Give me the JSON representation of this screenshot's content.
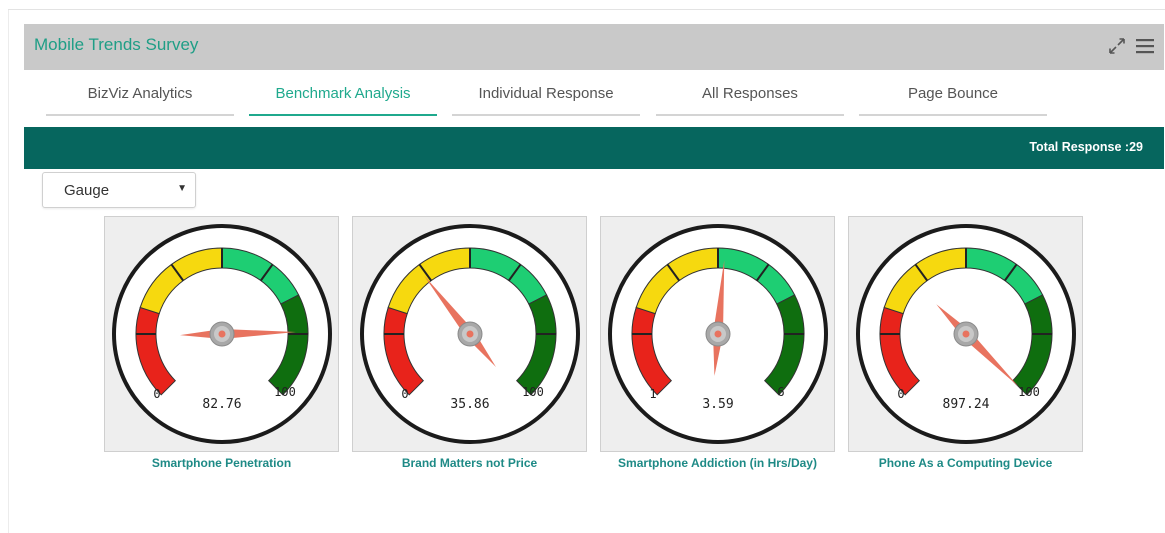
{
  "header": {
    "title": "Mobile Trends Survey",
    "icons": [
      "expand-icon",
      "menu-icon"
    ]
  },
  "tabs": [
    {
      "label": "BizViz Analytics",
      "active": false
    },
    {
      "label": "Benchmark Analysis",
      "active": true
    },
    {
      "label": "Individual Response",
      "active": false
    },
    {
      "label": "All Responses",
      "active": false
    },
    {
      "label": "Page Bounce",
      "active": false
    }
  ],
  "banner": {
    "total_response": "Total Response :29"
  },
  "chart_select": {
    "value": "Gauge"
  },
  "colors": {
    "accent": "#1fa98d",
    "banner": "#06665e",
    "needle": "#e8735f",
    "red": "#e8231b",
    "yellow": "#f6d90f",
    "light_green": "#1ece73",
    "dark_green": "#0f6e0f"
  },
  "chart_data": [
    {
      "type": "gauge",
      "title": "Smartphone Penetration",
      "min": "0",
      "max": "100",
      "value": "82.76"
    },
    {
      "type": "gauge",
      "title": "Brand Matters not Price",
      "min": "0",
      "max": "100",
      "value": "35.86"
    },
    {
      "type": "gauge",
      "title": "Smartphone Addiction (in Hrs/Day)",
      "min": "1",
      "max": "6",
      "value": "3.59"
    },
    {
      "type": "gauge",
      "title": "Phone As a Computing Device",
      "min": "0",
      "max": "100",
      "value": "897.24"
    }
  ]
}
